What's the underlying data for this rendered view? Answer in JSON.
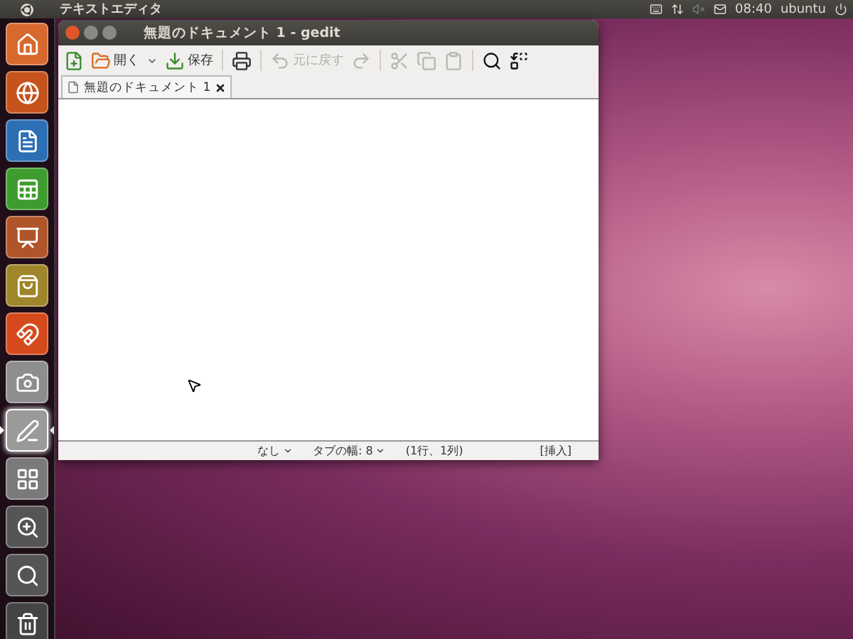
{
  "top_panel": {
    "app_title": "テキストエディタ",
    "indicators": [
      {
        "kind": "keyboard",
        "disabled": false
      },
      {
        "kind": "network",
        "disabled": false
      },
      {
        "kind": "sound",
        "disabled": true
      },
      {
        "kind": "mail",
        "disabled": false
      }
    ],
    "clock": "08:40",
    "user": "ubuntu"
  },
  "launcher": [
    {
      "kind": "home",
      "running": false
    },
    {
      "kind": "browser",
      "running": false
    },
    {
      "kind": "writer",
      "running": false
    },
    {
      "kind": "calc",
      "running": false
    },
    {
      "kind": "impress",
      "running": false
    },
    {
      "kind": "software",
      "running": false
    },
    {
      "kind": "cloud",
      "running": false
    },
    {
      "kind": "camera",
      "running": false
    },
    {
      "kind": "editor",
      "running": true
    },
    {
      "kind": "workspaces",
      "running": false
    },
    {
      "kind": "zoom",
      "running": false
    },
    {
      "kind": "search",
      "running": false
    },
    {
      "kind": "trash",
      "running": false
    }
  ],
  "window": {
    "title": "無題のドキュメント 1 - gedit",
    "toolbar": [
      {
        "kind": "new",
        "disabled": false
      },
      {
        "kind": "open",
        "label": "開く",
        "disabled": false
      },
      {
        "kind": "dropdown",
        "disabled": false
      },
      {
        "kind": "save",
        "label": "保存",
        "disabled": false
      },
      {
        "kind": "separator"
      },
      {
        "kind": "print",
        "disabled": false
      },
      {
        "kind": "separator"
      },
      {
        "kind": "undo",
        "label": "元に戻す",
        "disabled": true
      },
      {
        "kind": "redo",
        "disabled": true
      },
      {
        "kind": "separator"
      },
      {
        "kind": "cut",
        "disabled": true
      },
      {
        "kind": "copy",
        "disabled": true
      },
      {
        "kind": "paste",
        "disabled": true
      },
      {
        "kind": "separator"
      },
      {
        "kind": "find",
        "disabled": false
      },
      {
        "kind": "replace",
        "disabled": false
      }
    ],
    "tabs": [
      {
        "label": "無題のドキュメント 1",
        "selected": true
      }
    ],
    "status_bar": {
      "syntax": "なし",
      "tab_width": "タブの幅: 8",
      "position": "(1行、1列)",
      "mode": "[挿入]"
    }
  }
}
